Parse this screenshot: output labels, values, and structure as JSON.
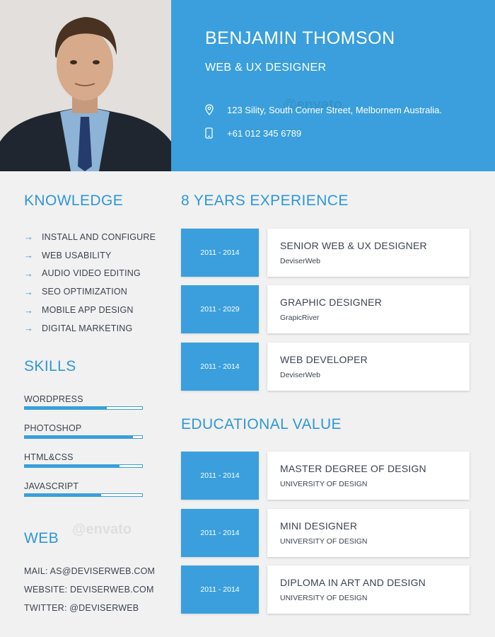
{
  "header": {
    "name": "BENJAMIN THOMSON",
    "role": "WEB & UX DESIGNER",
    "address": "123 Sility, South Corner Street, Melbornem Australia.",
    "phone": "+61 012 345 6789",
    "address_icon": "location-pin-icon",
    "phone_icon": "mobile-phone-icon"
  },
  "knowledge": {
    "title": "KNOWLEDGE",
    "items": [
      "INSTALL AND CONFIGURE",
      "WEB USABILITY",
      "AUDIO VIDEO EDITING",
      "SEO OPTIMIZATION",
      "MOBILE APP DESIGN",
      "DIGITAL MARKETING"
    ]
  },
  "skills": {
    "title": "SKILLS",
    "items": [
      {
        "label": "WORDPRESS",
        "level": 0.7
      },
      {
        "label": "PHOTOSHOP",
        "level": 0.92
      },
      {
        "label": "HTML&CSS",
        "level": 0.81
      },
      {
        "label": "JAVASCRIPT",
        "level": 0.65
      }
    ]
  },
  "web": {
    "title": "WEB",
    "mail": "MAIL: AS@DEVISERWEB.COM",
    "website": "WEBSITE: DEVISERWEB.COM",
    "twitter": "TWITTER: @DEVISERWEB"
  },
  "experience": {
    "title": "8 YEARS EXPERIENCE",
    "items": [
      {
        "date": "2011 - 2014",
        "title": "SENIOR WEB & UX DESIGNER",
        "sub": "DeviserWeb"
      },
      {
        "date": "2011 - 2029",
        "title": "GRAPHIC DESIGNER",
        "sub": "GrapicRiver"
      },
      {
        "date": "2011 - 2014",
        "title": "WEB DEVELOPER",
        "sub": "DeviserWeb"
      }
    ]
  },
  "education": {
    "title": "EDUCATIONAL VALUE",
    "items": [
      {
        "date": "2011 - 2014",
        "title": "MASTER DEGREE OF DESIGN",
        "sub": "UNIVERSITY OF DESIGN"
      },
      {
        "date": "2011 - 2014",
        "title": "MINI DESIGNER",
        "sub": "UNIVERSITY OF DESIGN"
      },
      {
        "date": "2011 - 2014",
        "title": "DIPLOMA IN ART AND DESIGN",
        "sub": "UNIVERSITY OF DESIGN"
      }
    ]
  },
  "colors": {
    "accent": "#3a9fdc",
    "text": "#3b4450",
    "background": "#f1f1f1"
  }
}
